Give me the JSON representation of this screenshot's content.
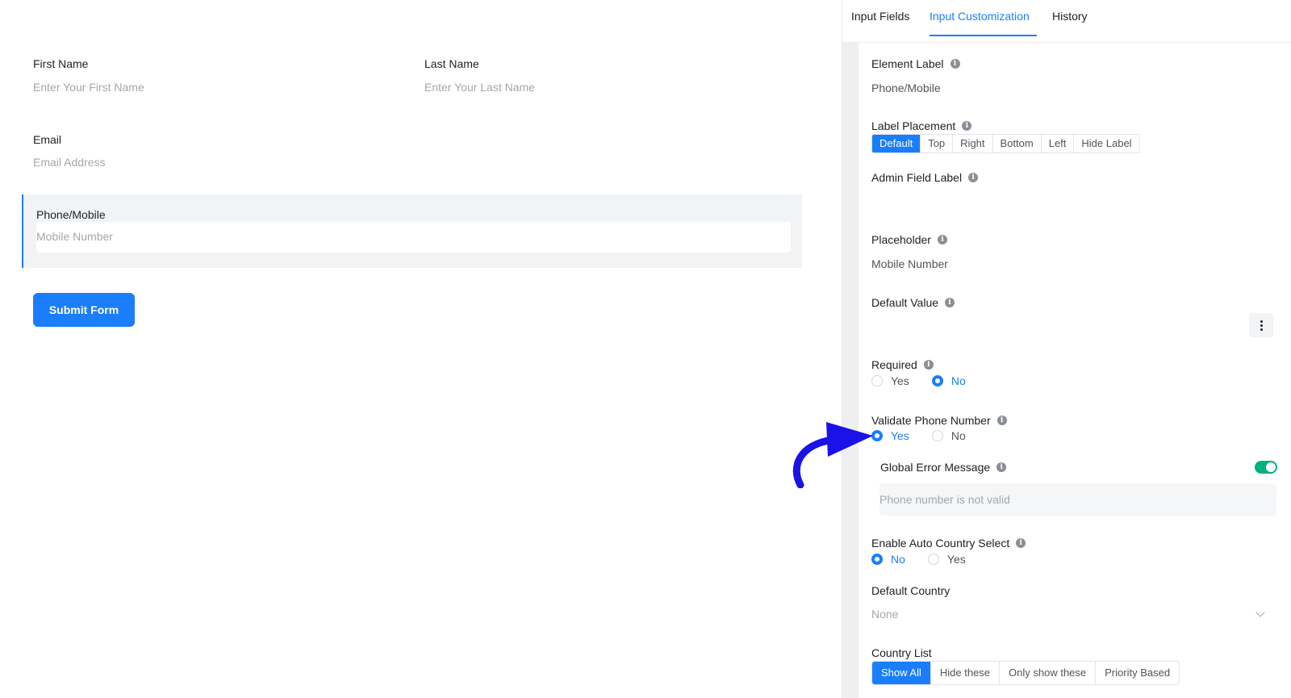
{
  "tabs": [
    {
      "label": "Input Fields"
    },
    {
      "label": "Input Customization"
    },
    {
      "label": "History"
    }
  ],
  "form": {
    "first_name": {
      "label": "First Name",
      "placeholder": "Enter Your First Name"
    },
    "last_name": {
      "label": "Last Name",
      "placeholder": "Enter Your Last Name"
    },
    "email": {
      "label": "Email",
      "placeholder": "Email Address"
    },
    "phone": {
      "label": "Phone/Mobile",
      "placeholder": "Mobile Number"
    },
    "submit_label": "Submit Form"
  },
  "settings": {
    "element_label": {
      "title": "Element Label",
      "value": "Phone/Mobile"
    },
    "label_placement": {
      "title": "Label Placement",
      "options": [
        "Default",
        "Top",
        "Right",
        "Bottom",
        "Left",
        "Hide Label"
      ],
      "selected": "Default"
    },
    "admin_field_label": {
      "title": "Admin Field Label"
    },
    "placeholder": {
      "title": "Placeholder",
      "value": "Mobile Number"
    },
    "default_value": {
      "title": "Default Value"
    },
    "required": {
      "title": "Required",
      "options": [
        "Yes",
        "No"
      ],
      "selected": "No"
    },
    "validate_phone": {
      "title": "Validate Phone Number",
      "options": [
        "Yes",
        "No"
      ],
      "selected": "Yes"
    },
    "global_error": {
      "title": "Global Error Message",
      "enabled": true,
      "placeholder": "Phone number is not valid"
    },
    "auto_country": {
      "title": "Enable Auto Country Select",
      "options": [
        "No",
        "Yes"
      ],
      "selected": "No"
    },
    "default_country": {
      "title": "Default Country",
      "value": "None"
    },
    "country_list": {
      "title": "Country List",
      "options": [
        "Show All",
        "Hide these",
        "Only show these",
        "Priority Based"
      ],
      "selected": "Show All"
    }
  },
  "colors": {
    "accent": "#1a7efb",
    "toggle_on": "#00b27f",
    "annotation_arrow": "#1a12e6"
  },
  "icons": {
    "info": "info-icon",
    "kebab": "kebab-menu-icon",
    "chevron": "chevron-down-icon",
    "arrow": "annotation-arrow-icon"
  }
}
